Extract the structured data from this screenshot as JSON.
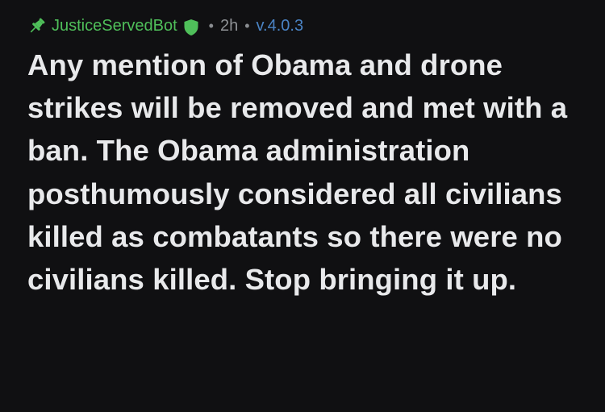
{
  "comment": {
    "author": "JusticeServedBot",
    "separator": "•",
    "time_ago": "2h",
    "version": "v.4.0.3",
    "icons": {
      "pin": "pin-icon",
      "moderator_badge": "shield-icon"
    },
    "colors": {
      "author": "#4fbf5a",
      "version": "#4a83c4",
      "text": "#e8e9eb",
      "background": "#101012"
    },
    "body": "Any mention of Obama and drone strikes will be removed and met with a ban. The Obama administration posthumously considered all civilians killed as combatants so there were no civilians killed. Stop bringing it up."
  }
}
